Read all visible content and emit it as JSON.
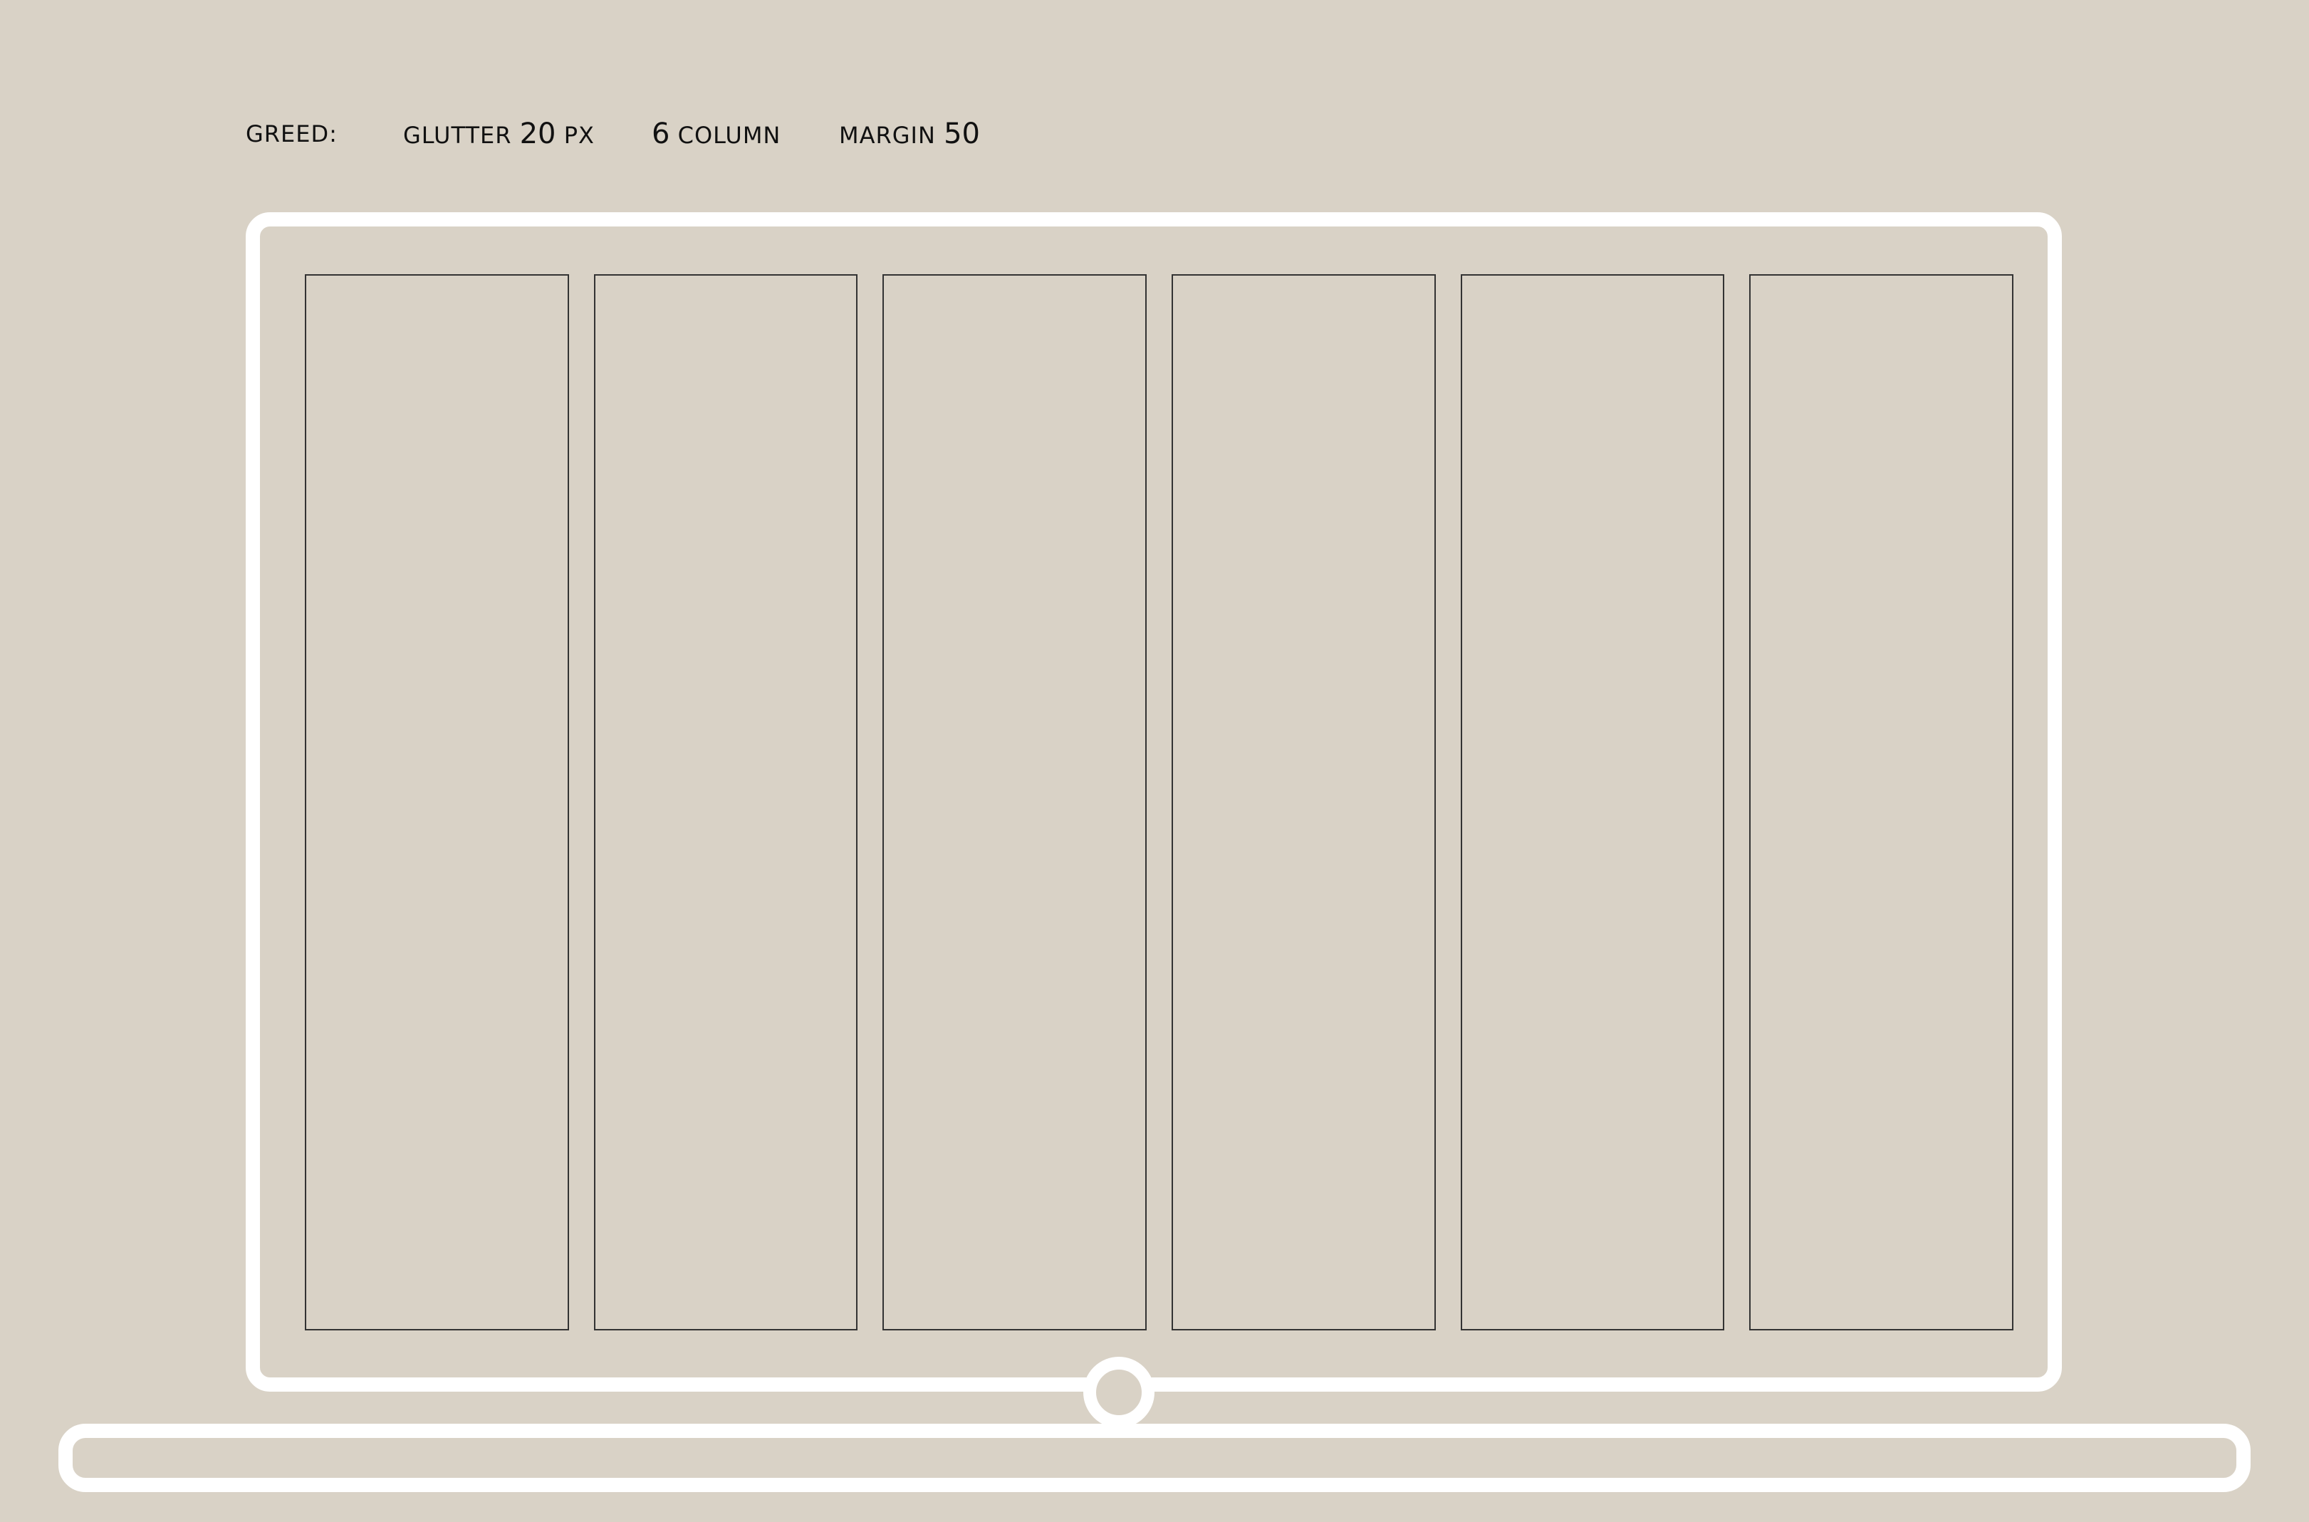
{
  "colors": {
    "background": "#d9d2c6",
    "frame": "#ffffff",
    "column_border": "#333333",
    "text": "#111111"
  },
  "header": {
    "greed_label": "GREED:",
    "gutter_label": "GLUTTER",
    "gutter_value": "20",
    "gutter_unit": "PX",
    "column_count": "6",
    "column_label": "COLUMN",
    "margin_label": "MARGIN",
    "margin_value": "50"
  },
  "grid": {
    "columns": 6
  },
  "icons": {
    "hinge": "laptop-hinge-icon"
  }
}
